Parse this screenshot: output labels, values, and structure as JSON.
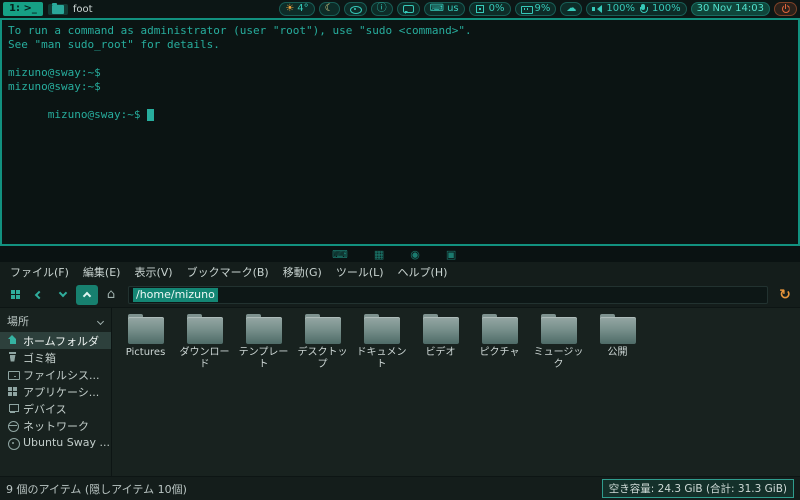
{
  "theme": {
    "accent": "#16a085",
    "terminal_foreground": "#27ad9d",
    "window_border": "#12917f",
    "warning_orange": "#e8953b",
    "power_red": "#e0653c"
  },
  "icons": {
    "sun": "☀",
    "moon": "☾",
    "cloud": "☁",
    "keyboard": "⌨",
    "info": "ⓘ",
    "home": "⌂",
    "refresh": "↻"
  },
  "topbar": {
    "workspace_label": "1: >_",
    "window_title": "foot",
    "modules": [
      {
        "name": "weather",
        "icon": "sun-icon",
        "label": "4°"
      },
      {
        "name": "night-mode",
        "icon": "moon-icon"
      },
      {
        "name": "idle-inhibitor",
        "icon": "eye-icon"
      },
      {
        "name": "info",
        "icon": "info-icon"
      },
      {
        "name": "notifications",
        "icon": "chat-icon"
      },
      {
        "name": "keyboard-layout",
        "icon": "keyboard-icon",
        "label": "us"
      },
      {
        "name": "cpu",
        "icon": "cpu-icon",
        "label": "0%"
      },
      {
        "name": "memory",
        "icon": "memory-icon",
        "label": "9%"
      },
      {
        "name": "network",
        "icon": "cloud-icon"
      },
      {
        "name": "volume",
        "icon": "speaker-icon",
        "label": "100%"
      },
      {
        "name": "microphone",
        "icon": "microphone-icon",
        "label": "100%"
      },
      {
        "name": "clock",
        "label": "30 Nov 14:03"
      },
      {
        "name": "power",
        "icon": "power-icon"
      }
    ]
  },
  "terminal": {
    "lines": [
      "To run a command as administrator (user \"root\"), use \"sudo <command>\".",
      "See \"man sudo_root\" for details.",
      "",
      "mizuno@sway:~$",
      "mizuno@sway:~$",
      "mizuno@sway:~$"
    ]
  },
  "wallpaper_glyphs": [
    "⌨",
    "▦",
    "◉",
    "▣"
  ],
  "filemanager": {
    "menubar": [
      "ファイル(F)",
      "編集(E)",
      "表示(V)",
      "ブックマーク(B)",
      "移動(G)",
      "ツール(L)",
      "ヘルプ(H)"
    ],
    "toolbar": {
      "path": "/home/mizuno",
      "buttons": [
        {
          "name": "view-toggle",
          "icon": "grid-icon"
        },
        {
          "name": "back",
          "icon": "chevron-left-icon"
        },
        {
          "name": "history",
          "icon": "chevron-down-icon"
        },
        {
          "name": "up",
          "icon": "chevron-up-icon"
        },
        {
          "name": "home",
          "icon": "home-icon"
        },
        {
          "name": "refresh",
          "icon": "refresh-icon"
        }
      ]
    },
    "sidebar": {
      "header": "場所",
      "items": [
        {
          "label": "ホームフォルダ",
          "icon": "home-icon",
          "selected": true
        },
        {
          "label": "ゴミ箱",
          "icon": "trash-icon"
        },
        {
          "label": "ファイルシス...",
          "icon": "filesystem-icon"
        },
        {
          "label": "アプリケーシ...",
          "icon": "applications-icon"
        },
        {
          "label": "デバイス",
          "icon": "devices-icon"
        },
        {
          "label": "ネットワーク",
          "icon": "network-icon"
        },
        {
          "label": "Ubuntu Sway ...",
          "icon": "disk-icon",
          "eject": true
        }
      ]
    },
    "folders": [
      "Pictures",
      "ダウンロード",
      "テンプレート",
      "デスクトップ",
      "ドキュメント",
      "ビデオ",
      "ピクチャ",
      "ミュージック",
      "公開"
    ],
    "statusbar": {
      "items_text": "9 個のアイテム (隠しアイテム 10個)",
      "free_space_text": "空き容量: 24.3 GiB (合計: 31.3 GiB)"
    }
  }
}
